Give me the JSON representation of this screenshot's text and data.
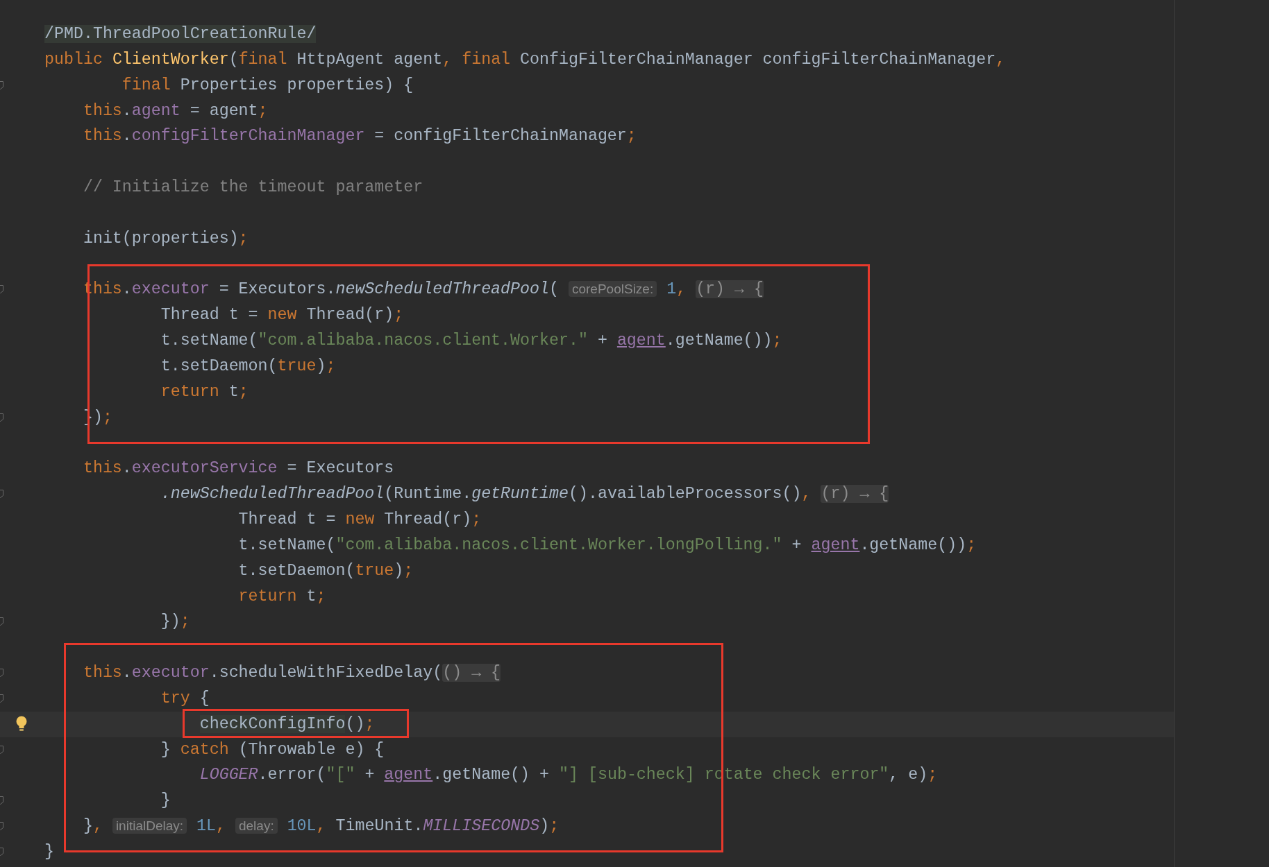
{
  "editor": {
    "lines": [
      {
        "kind": "code",
        "fold": false,
        "current": false,
        "tokens": [
          {
            "text": "/PMD.ThreadPoolCreationRule/",
            "kind": "marked"
          }
        ]
      },
      {
        "kind": "code",
        "fold": false,
        "current": false,
        "tokens": [
          {
            "text": "public ",
            "kind": "kw"
          },
          {
            "text": "ClientWorker",
            "kind": "decl"
          },
          {
            "text": "(",
            "kind": "plain"
          },
          {
            "text": "final ",
            "kind": "kw"
          },
          {
            "text": "HttpAgent agent",
            "kind": "plain"
          },
          {
            "text": ", ",
            "kind": "kw"
          },
          {
            "text": "final ",
            "kind": "kw"
          },
          {
            "text": "ConfigFilterChainManager configFilterChainManager",
            "kind": "plain"
          },
          {
            "text": ",",
            "kind": "kw"
          }
        ]
      },
      {
        "kind": "code",
        "fold": true,
        "current": false,
        "tokens": [
          {
            "text": "        final ",
            "kind": "kw"
          },
          {
            "text": "Properties properties) {",
            "kind": "plain"
          }
        ]
      },
      {
        "kind": "code",
        "fold": false,
        "current": false,
        "tokens": [
          {
            "text": "    this",
            "kind": "kw"
          },
          {
            "text": ".",
            "kind": "plain"
          },
          {
            "text": "agent",
            "kind": "field"
          },
          {
            "text": " = agent",
            "kind": "plain"
          },
          {
            "text": ";",
            "kind": "kw"
          }
        ]
      },
      {
        "kind": "code",
        "fold": false,
        "current": false,
        "tokens": [
          {
            "text": "    this",
            "kind": "kw"
          },
          {
            "text": ".",
            "kind": "plain"
          },
          {
            "text": "configFilterChainManager",
            "kind": "field"
          },
          {
            "text": " = configFilterChainManager",
            "kind": "plain"
          },
          {
            "text": ";",
            "kind": "kw"
          }
        ]
      },
      {
        "kind": "blank"
      },
      {
        "kind": "code",
        "fold": false,
        "current": false,
        "tokens": [
          {
            "text": "    // Initialize the timeout parameter",
            "kind": "comment"
          }
        ]
      },
      {
        "kind": "blank"
      },
      {
        "kind": "code",
        "fold": false,
        "current": false,
        "tokens": [
          {
            "text": "    init(properties)",
            "kind": "plain"
          },
          {
            "text": ";",
            "kind": "kw"
          }
        ]
      },
      {
        "kind": "blank"
      },
      {
        "kind": "code",
        "fold": true,
        "current": false,
        "tokens": [
          {
            "text": "    this",
            "kind": "kw"
          },
          {
            "text": ".",
            "kind": "plain"
          },
          {
            "text": "executor",
            "kind": "field"
          },
          {
            "text": " = Executors.",
            "kind": "plain"
          },
          {
            "text": "newScheduledThreadPool",
            "kind": "italic"
          },
          {
            "text": "( ",
            "kind": "plain"
          },
          {
            "text": "corePoolSize:",
            "kind": "hint"
          },
          {
            "text": " 1",
            "kind": "num"
          },
          {
            "text": ", ",
            "kind": "kw"
          },
          {
            "text": "(r) → {",
            "kind": "lambda"
          }
        ]
      },
      {
        "kind": "code",
        "fold": false,
        "current": false,
        "tokens": [
          {
            "text": "            Thread t = ",
            "kind": "plain"
          },
          {
            "text": "new ",
            "kind": "kw"
          },
          {
            "text": "Thread(r)",
            "kind": "plain"
          },
          {
            "text": ";",
            "kind": "kw"
          }
        ]
      },
      {
        "kind": "code",
        "fold": false,
        "current": false,
        "tokens": [
          {
            "text": "            t.setName(",
            "kind": "plain"
          },
          {
            "text": "\"com.alibaba.nacos.client.Worker.\"",
            "kind": "str"
          },
          {
            "text": " + ",
            "kind": "plain"
          },
          {
            "text": "agent",
            "kind": "link"
          },
          {
            "text": ".getName())",
            "kind": "plain"
          },
          {
            "text": ";",
            "kind": "kw"
          }
        ]
      },
      {
        "kind": "code",
        "fold": false,
        "current": false,
        "tokens": [
          {
            "text": "            t.setDaemon(",
            "kind": "plain"
          },
          {
            "text": "true",
            "kind": "kw"
          },
          {
            "text": ")",
            "kind": "plain"
          },
          {
            "text": ";",
            "kind": "kw"
          }
        ]
      },
      {
        "kind": "code",
        "fold": false,
        "current": false,
        "tokens": [
          {
            "text": "            return ",
            "kind": "kw"
          },
          {
            "text": "t",
            "kind": "plain"
          },
          {
            "text": ";",
            "kind": "kw"
          }
        ]
      },
      {
        "kind": "code",
        "fold": true,
        "current": false,
        "tokens": [
          {
            "text": "    })",
            "kind": "plain"
          },
          {
            "text": ";",
            "kind": "kw"
          }
        ]
      },
      {
        "kind": "blank"
      },
      {
        "kind": "code",
        "fold": false,
        "current": false,
        "tokens": [
          {
            "text": "    this",
            "kind": "kw"
          },
          {
            "text": ".",
            "kind": "plain"
          },
          {
            "text": "executorService",
            "kind": "field"
          },
          {
            "text": " = Executors",
            "kind": "plain"
          }
        ]
      },
      {
        "kind": "code",
        "fold": true,
        "current": false,
        "tokens": [
          {
            "text": "            .newScheduledThreadPool",
            "kind": "italic"
          },
          {
            "text": "(Runtime.",
            "kind": "plain"
          },
          {
            "text": "getRuntime",
            "kind": "italic"
          },
          {
            "text": "().availableProcessors()",
            "kind": "plain"
          },
          {
            "text": ", ",
            "kind": "kw"
          },
          {
            "text": "(r) → {",
            "kind": "lambda"
          }
        ]
      },
      {
        "kind": "code",
        "fold": false,
        "current": false,
        "tokens": [
          {
            "text": "                    Thread t = ",
            "kind": "plain"
          },
          {
            "text": "new ",
            "kind": "kw"
          },
          {
            "text": "Thread(r)",
            "kind": "plain"
          },
          {
            "text": ";",
            "kind": "kw"
          }
        ]
      },
      {
        "kind": "code",
        "fold": false,
        "current": false,
        "tokens": [
          {
            "text": "                    t.setName(",
            "kind": "plain"
          },
          {
            "text": "\"com.alibaba.nacos.client.Worker.longPolling.\"",
            "kind": "str"
          },
          {
            "text": " + ",
            "kind": "plain"
          },
          {
            "text": "agent",
            "kind": "link"
          },
          {
            "text": ".getName())",
            "kind": "plain"
          },
          {
            "text": ";",
            "kind": "kw"
          }
        ]
      },
      {
        "kind": "code",
        "fold": false,
        "current": false,
        "tokens": [
          {
            "text": "                    t.setDaemon(",
            "kind": "plain"
          },
          {
            "text": "true",
            "kind": "kw"
          },
          {
            "text": ")",
            "kind": "plain"
          },
          {
            "text": ";",
            "kind": "kw"
          }
        ]
      },
      {
        "kind": "code",
        "fold": false,
        "current": false,
        "tokens": [
          {
            "text": "                    return ",
            "kind": "kw"
          },
          {
            "text": "t",
            "kind": "plain"
          },
          {
            "text": ";",
            "kind": "kw"
          }
        ]
      },
      {
        "kind": "code",
        "fold": true,
        "current": false,
        "tokens": [
          {
            "text": "            })",
            "kind": "plain"
          },
          {
            "text": ";",
            "kind": "kw"
          }
        ]
      },
      {
        "kind": "blank"
      },
      {
        "kind": "code",
        "fold": true,
        "current": false,
        "tokens": [
          {
            "text": "    this",
            "kind": "kw"
          },
          {
            "text": ".",
            "kind": "plain"
          },
          {
            "text": "executor",
            "kind": "field"
          },
          {
            "text": ".scheduleWithFixedDelay(",
            "kind": "plain"
          },
          {
            "text": "() → {",
            "kind": "lambda"
          }
        ]
      },
      {
        "kind": "code",
        "fold": true,
        "current": false,
        "tokens": [
          {
            "text": "            try ",
            "kind": "kw"
          },
          {
            "text": "{",
            "kind": "plain"
          }
        ]
      },
      {
        "kind": "code",
        "fold": false,
        "current": true,
        "tokens": [
          {
            "text": "                checkConfigInfo",
            "kind": "marked"
          },
          {
            "text": "()",
            "kind": "plain"
          },
          {
            "text": ";",
            "kind": "kw"
          }
        ]
      },
      {
        "kind": "code",
        "fold": true,
        "current": false,
        "tokens": [
          {
            "text": "            } ",
            "kind": "plain"
          },
          {
            "text": "catch ",
            "kind": "kw"
          },
          {
            "text": "(Throwable e) {",
            "kind": "plain"
          }
        ]
      },
      {
        "kind": "code",
        "fold": false,
        "current": false,
        "tokens": [
          {
            "text": "                LOGGER",
            "kind": "static"
          },
          {
            "text": ".error(",
            "kind": "plain"
          },
          {
            "text": "\"[\"",
            "kind": "str"
          },
          {
            "text": " + ",
            "kind": "plain"
          },
          {
            "text": "agent",
            "kind": "link"
          },
          {
            "text": ".getName() + ",
            "kind": "plain"
          },
          {
            "text": "\"] [sub-check] rotate check error\"",
            "kind": "str"
          },
          {
            "text": ", e)",
            "kind": "plain"
          },
          {
            "text": ";",
            "kind": "kw"
          }
        ]
      },
      {
        "kind": "code",
        "fold": true,
        "current": false,
        "tokens": [
          {
            "text": "            }",
            "kind": "plain"
          }
        ]
      },
      {
        "kind": "code",
        "fold": true,
        "current": false,
        "tokens": [
          {
            "text": "    }",
            "kind": "plain"
          },
          {
            "text": ", ",
            "kind": "kw"
          },
          {
            "text": "initialDelay:",
            "kind": "hint"
          },
          {
            "text": " 1L",
            "kind": "num"
          },
          {
            "text": ", ",
            "kind": "kw"
          },
          {
            "text": "delay:",
            "kind": "hint"
          },
          {
            "text": " 10L",
            "kind": "num"
          },
          {
            "text": ", ",
            "kind": "kw"
          },
          {
            "text": "TimeUnit.",
            "kind": "plain"
          },
          {
            "text": "MILLISECONDS",
            "kind": "static"
          },
          {
            "text": ")",
            "kind": "plain"
          },
          {
            "text": ";",
            "kind": "kw"
          }
        ]
      },
      {
        "kind": "code",
        "fold": true,
        "current": false,
        "tokens": [
          {
            "text": "}",
            "kind": "plain"
          }
        ]
      }
    ]
  }
}
